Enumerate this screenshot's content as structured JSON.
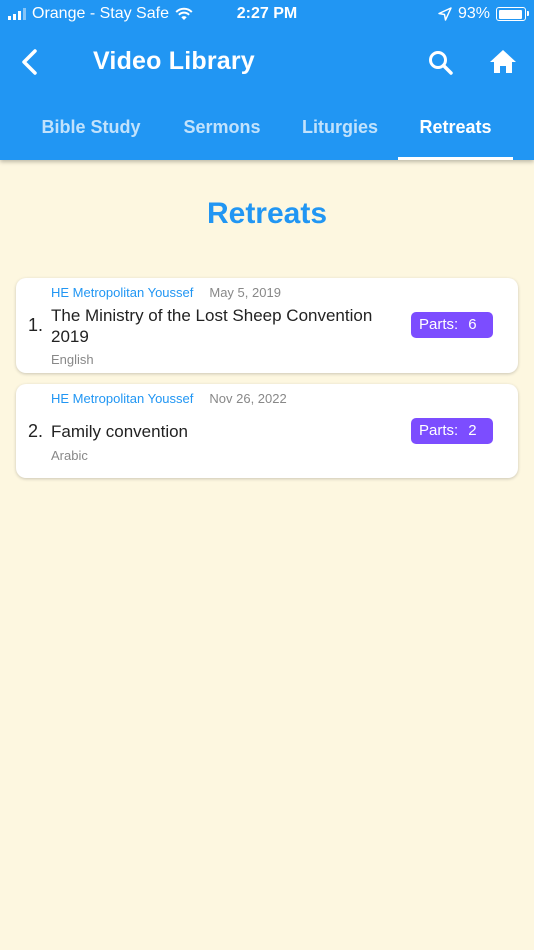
{
  "status_bar": {
    "carrier": "Orange - Stay Safe",
    "time": "2:27 PM",
    "battery": "93%"
  },
  "app_bar": {
    "title": "Video Library",
    "back_icon": "back-arrow-icon",
    "search_icon": "search-icon",
    "home_icon": "home-icon"
  },
  "tabs": [
    {
      "label": "Bible Study"
    },
    {
      "label": "Sermons"
    },
    {
      "label": "Liturgies"
    },
    {
      "label": "Retreats",
      "active": true
    }
  ],
  "page_title": "Retreats",
  "items": [
    {
      "number": "1.",
      "speaker": "HE Metropolitan Youssef",
      "date": "May 5, 2019",
      "title": "The Ministry of the Lost Sheep Convention 2019",
      "language": "English",
      "parts_label": "Parts:",
      "parts_count": "6"
    },
    {
      "number": "2.",
      "speaker": "HE Metropolitan Youssef",
      "date": "Nov 26, 2022",
      "title": "Family convention",
      "language": "Arabic",
      "parts_label": "Parts:",
      "parts_count": "2"
    }
  ],
  "colors": {
    "primary": "#2196f3",
    "background": "#fdf7e0",
    "parts_badge": "#7c4dff"
  }
}
